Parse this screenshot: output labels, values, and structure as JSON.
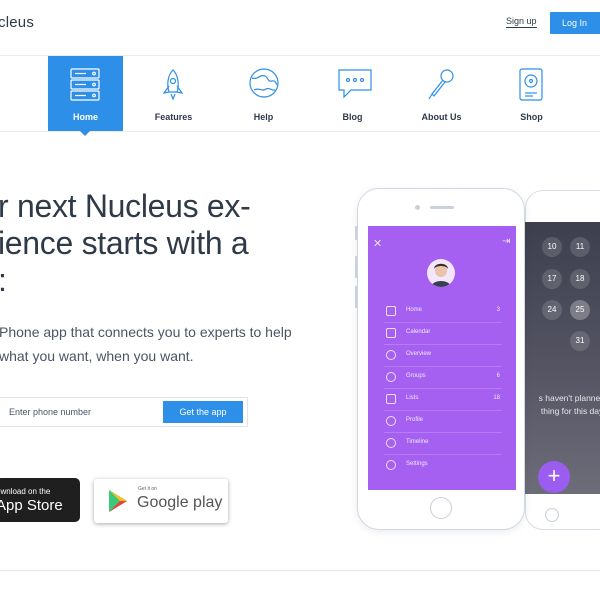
{
  "header": {
    "brand": "cleus",
    "signup_label": "Sign up",
    "login_label": "Log In"
  },
  "nav": {
    "items": [
      {
        "label": "Home",
        "icon": "server-icon",
        "active": true
      },
      {
        "label": "Features",
        "icon": "rocket-icon"
      },
      {
        "label": "Help",
        "icon": "globe-icon"
      },
      {
        "label": "Blog",
        "icon": "chat-bubble-icon"
      },
      {
        "label": "About Us",
        "icon": "microphone-icon"
      },
      {
        "label": "Shop",
        "icon": "hard-drive-icon"
      }
    ]
  },
  "hero": {
    "title": "r next Nucleus ex-\nience starts with a\n:",
    "subtitle": "Phone app that connects you to experts to help\nwhat you want, when you want.",
    "phone_placeholder": "Enter phone number",
    "cta_label": "Get the app"
  },
  "stores": {
    "apple_small": "ownload on the",
    "apple_big": "App Store",
    "google_small": "Get it on",
    "google_big": "Google play"
  },
  "phone_menu": {
    "items": [
      {
        "label": "Home",
        "count": "3",
        "icon": "home-icon"
      },
      {
        "label": "Calendar",
        "count": "",
        "icon": "calendar-icon"
      },
      {
        "label": "Overview",
        "count": "",
        "icon": "pie-chart-icon"
      },
      {
        "label": "Groups",
        "count": "6",
        "icon": "groups-icon"
      },
      {
        "label": "Lists",
        "count": "18",
        "icon": "list-icon"
      },
      {
        "label": "Profile",
        "count": "",
        "icon": "user-icon"
      },
      {
        "label": "Timeline",
        "count": "",
        "icon": "clock-icon"
      },
      {
        "label": "Settings",
        "count": "",
        "icon": "gear-icon"
      }
    ]
  },
  "phone_back": {
    "days": [
      "10",
      "11",
      "17",
      "18",
      "24",
      "25",
      "31"
    ],
    "highlighted_day": "25",
    "message": "s haven't planned\nthing for this day."
  },
  "colors": {
    "accent": "#2d8fe8",
    "purple": "#a560f2",
    "text": "#2f3a48"
  }
}
